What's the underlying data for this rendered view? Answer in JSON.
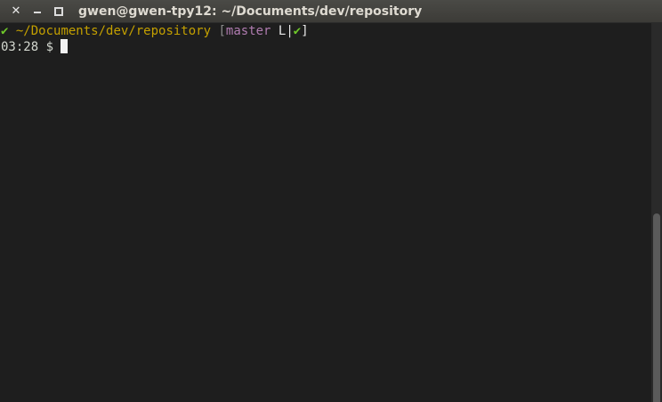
{
  "window": {
    "title": "gwen@gwen-tpy12: ~/Documents/dev/repository",
    "close_glyph": "✕",
    "min_glyph": "",
    "max_glyph": ""
  },
  "terminal": {
    "prompt_line": {
      "status_check": "✔",
      "path": "~/Documents/dev/repository",
      "bracket_open": "[",
      "branch": "master",
      "local_marker": "L",
      "separator": "|",
      "clean_check": "✔",
      "bracket_close": "]"
    },
    "input_line": {
      "time": "03:28",
      "dollar": "$"
    }
  },
  "colors": {
    "ok_green": "#6fc82a",
    "path_yellow": "#c4a000",
    "branch_purple": "#b07cb0",
    "background": "#1e1e1e"
  }
}
